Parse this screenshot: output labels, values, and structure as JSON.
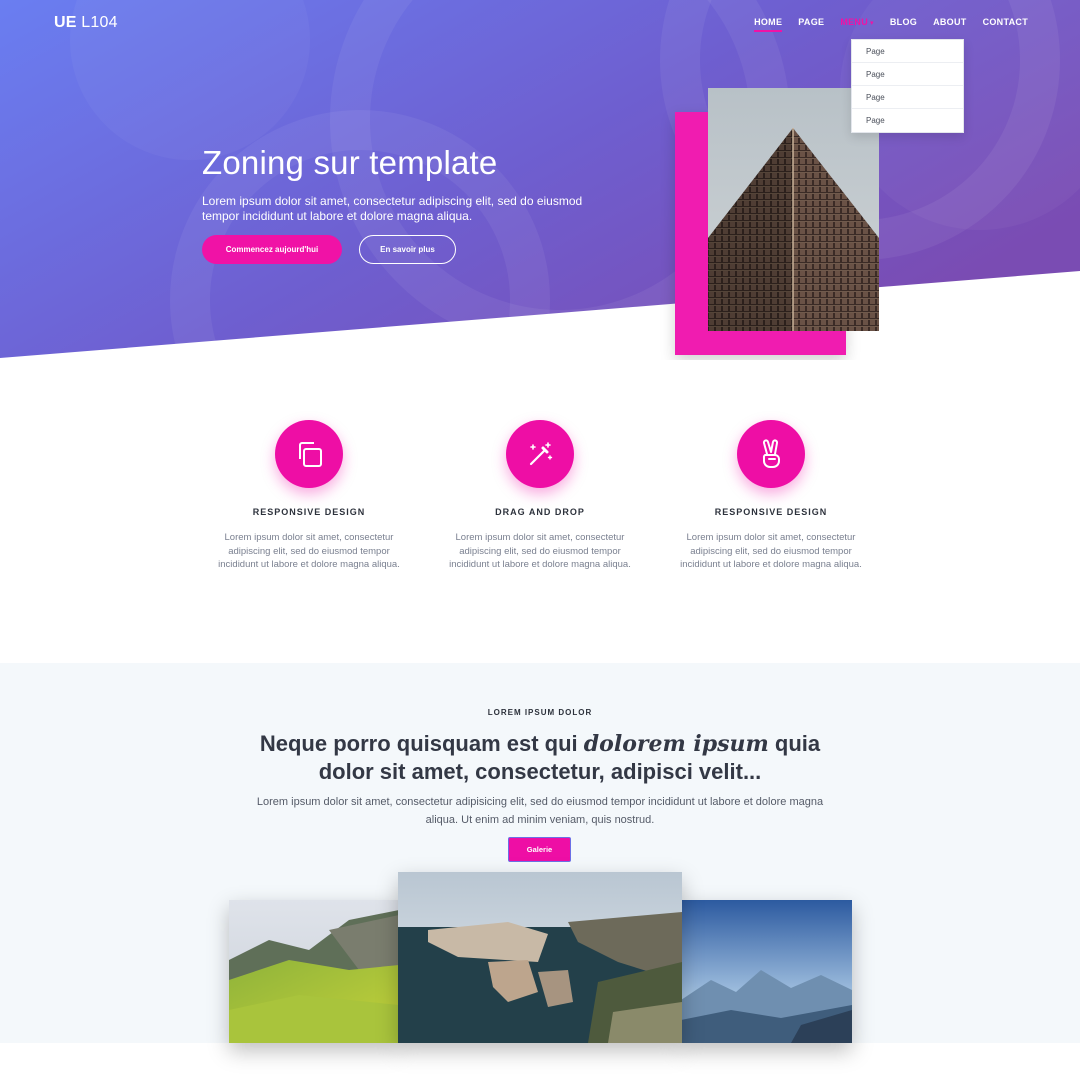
{
  "header": {
    "logo_bold": "UE",
    "logo_light": " L104",
    "nav": [
      {
        "label": "HOME"
      },
      {
        "label": "PAGE"
      },
      {
        "label": "MENU"
      },
      {
        "label": "BLOG"
      },
      {
        "label": "ABOUT"
      },
      {
        "label": "CONTACT"
      }
    ],
    "dropdown": [
      "Page",
      "Page",
      "Page",
      "Page"
    ]
  },
  "hero": {
    "title": "Zoning sur template",
    "subtitle": "Lorem ipsum dolor sit amet, consectetur adipiscing elit, sed do eiusmod tempor incididunt ut labore et dolore magna aliqua.",
    "primary_button": "Commencez aujourd'hui",
    "secondary_button": "En savoir plus"
  },
  "features": [
    {
      "icon": "copy-icon",
      "title": "RESPONSIVE DESIGN",
      "text": "Lorem ipsum dolor sit amet, consectetur adipiscing elit, sed do eiusmod tempor incididunt ut labore et dolore magna aliqua."
    },
    {
      "icon": "magic-wand-icon",
      "title": "DRAG AND DROP",
      "text": "Lorem ipsum dolor sit amet, consectetur adipiscing elit, sed do eiusmod tempor incididunt ut labore et dolore magna aliqua."
    },
    {
      "icon": "peace-hand-icon",
      "title": "RESPONSIVE DESIGN",
      "text": "Lorem ipsum dolor sit amet, consectetur adipiscing elit, sed do eiusmod tempor incididunt ut labore et dolore magna aliqua."
    }
  ],
  "section2": {
    "eyebrow": "LOREM IPSUM DOLOR",
    "headline_part1": "Neque porro quisquam est qui ",
    "headline_em": "dolorem ipsum",
    "headline_part2": " quia dolor sit amet, consectetur, adipisci velit...",
    "body": "Lorem ipsum dolor sit amet, consectetur adipisicing elit, sed do eiusmod tempor incididunt ut labore et dolore magna aliqua. Ut enim ad minim veniam, quis nostrud.",
    "button": "Galerie"
  },
  "colors": {
    "accent": "#ee0ea5",
    "hero_gradient_start": "#6b7ff0",
    "hero_gradient_end": "#7a4fb8",
    "section_bg": "#f4f8fb"
  }
}
